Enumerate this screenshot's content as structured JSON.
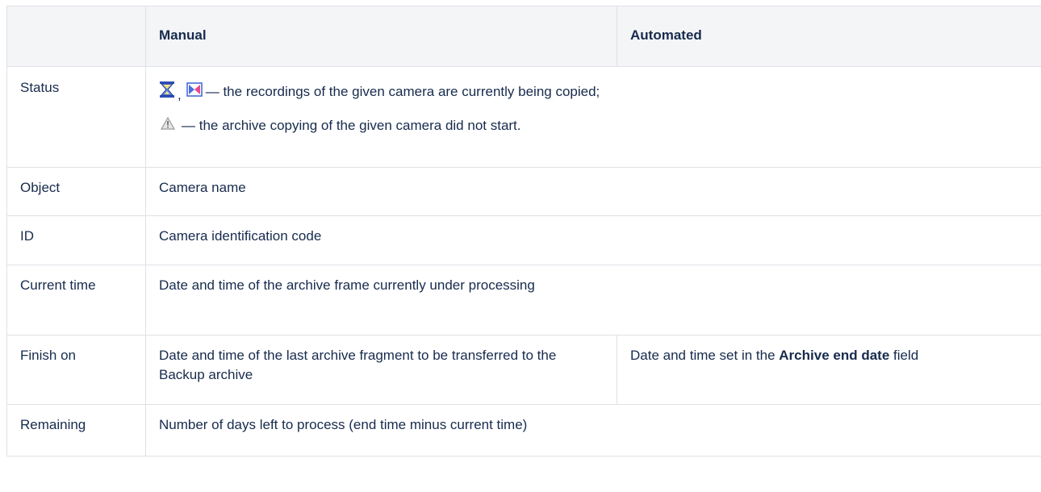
{
  "header": {
    "col1": "",
    "col2": "Manual",
    "col3": "Automated"
  },
  "rows": {
    "status": {
      "label": "Status",
      "line1_icons": [
        "hourglass-icon",
        "bowtie-icon"
      ],
      "line1_comma": ",",
      "line1_text": "— the recordings of the given camera are currently being copied;",
      "line2_icon": "warning-icon",
      "line2_text": "— the archive copying of the given camera did not start."
    },
    "object": {
      "label": "Object",
      "value": "Camera name"
    },
    "id": {
      "label": "ID",
      "value": "Camera identification code"
    },
    "current_time": {
      "label": "Current time",
      "value": "Date and time of the archive frame currently under processing"
    },
    "finish_on": {
      "label": "Finish on",
      "manual": "Date and time of the last archive fragment to be transferred to the Backup archive",
      "automated_prefix": "Date and time set in the",
      "automated_bold": "Archive end date",
      "automated_suffix": "field"
    },
    "remaining": {
      "label": "Remaining",
      "value": "Number of days left to process (end time minus current time)"
    }
  }
}
